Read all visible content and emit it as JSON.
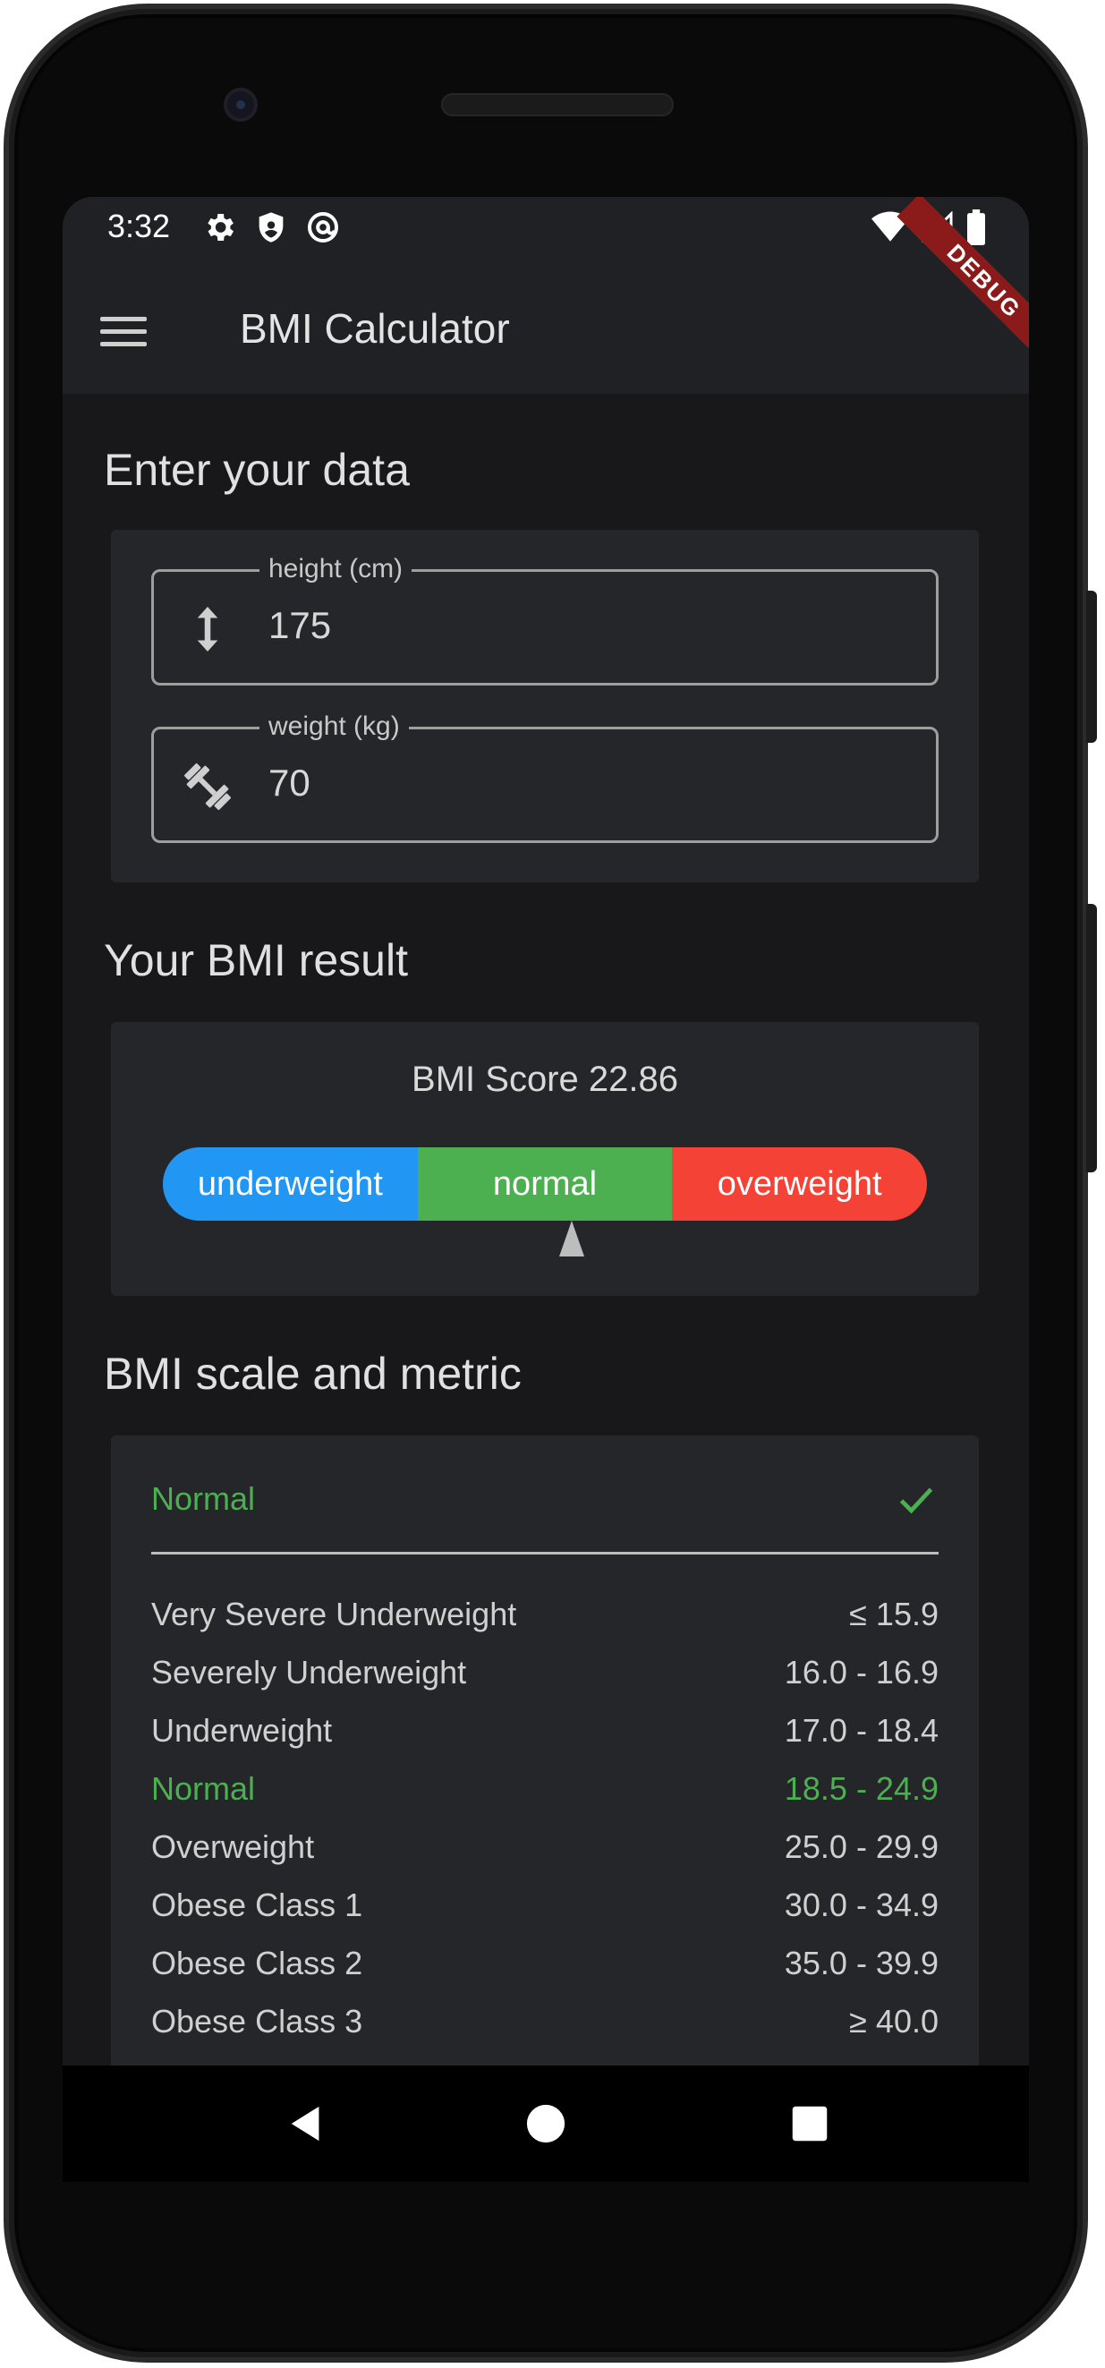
{
  "status_bar": {
    "time": "3:32",
    "left_icons": [
      "gear-icon",
      "shield-icon",
      "at-sign-icon"
    ],
    "right_icons": [
      "wifi-icon",
      "signal-icon",
      "battery-icon"
    ]
  },
  "app_bar": {
    "title": "BMI Calculator",
    "debug_badge": "DEBUG"
  },
  "input_section": {
    "title": "Enter your data",
    "height": {
      "label": "height (cm)",
      "value": "175",
      "icon": "vertical-arrows-icon"
    },
    "weight": {
      "label": "weight (kg)",
      "value": "70",
      "icon": "dumbbell-icon"
    }
  },
  "result_section": {
    "title": "Your BMI result",
    "score_text": "BMI Score 22.86",
    "scale": {
      "segments": [
        "underweight",
        "normal",
        "overweight"
      ],
      "colors": {
        "underweight": "#2196f3",
        "normal": "#4caf50",
        "overweight": "#f44336"
      },
      "pointer_fraction": 0.535
    }
  },
  "metric_section": {
    "title": "BMI scale and metric",
    "selected": "Normal",
    "rows": [
      {
        "name": "Very Severe Underweight",
        "range": "≤ 15.9",
        "active": false
      },
      {
        "name": "Severely Underweight",
        "range": "16.0 - 16.9",
        "active": false
      },
      {
        "name": "Underweight",
        "range": "17.0 - 18.4",
        "active": false
      },
      {
        "name": "Normal",
        "range": "18.5 - 24.9",
        "active": true
      },
      {
        "name": "Overweight",
        "range": "25.0 - 29.9",
        "active": false
      },
      {
        "name": "Obese Class 1",
        "range": "30.0 - 34.9",
        "active": false
      },
      {
        "name": "Obese Class 2",
        "range": "35.0 - 39.9",
        "active": false
      },
      {
        "name": "Obese Class 3",
        "range": "≥ 40.0",
        "active": false
      }
    ]
  },
  "nav_bar": {
    "buttons": [
      "back-icon",
      "home-icon",
      "recents-icon"
    ]
  }
}
